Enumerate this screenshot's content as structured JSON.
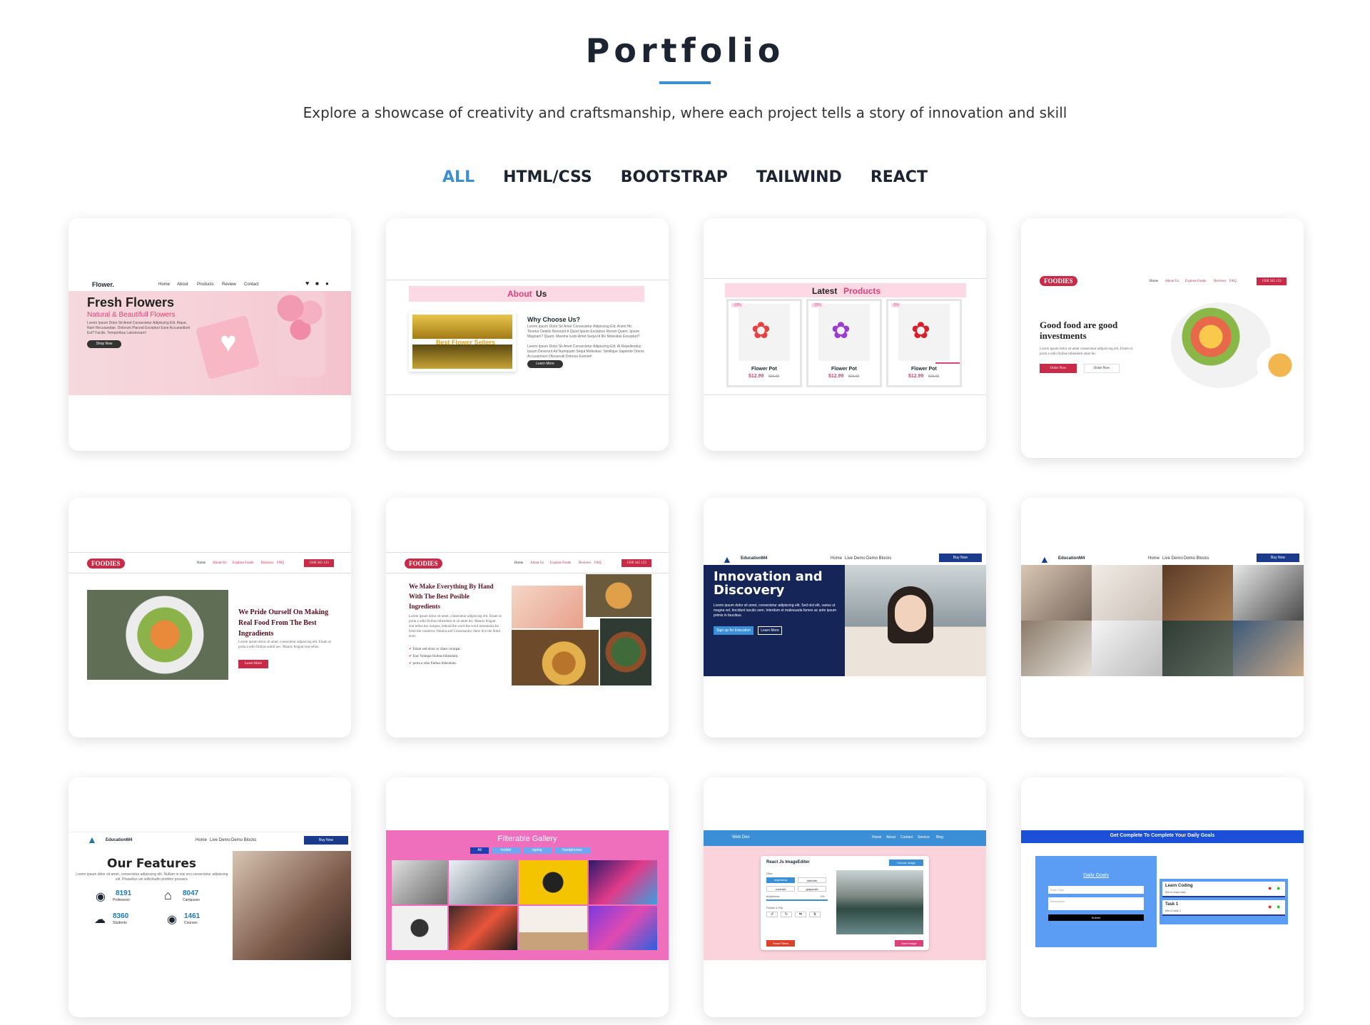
{
  "header": {
    "title": "Portfolio",
    "subtitle": "Explore a showcase of creativity and craftsmanship, where each project tells a story of innovation and skill"
  },
  "filters": [
    "ALL",
    "HTML/CSS",
    "BOOTSTRAP",
    "TAILWIND",
    "REACT"
  ],
  "accent": "#3a8fd6",
  "p1": {
    "logo": "Flower.",
    "nav": [
      "Home",
      "About",
      "Products",
      "Review",
      "Contact"
    ],
    "h": "Fresh Flowers",
    "sub": "Natural & Beautifull Flowers",
    "text": "Lorem Ipsum Dolor Sit Amet Consectetur Adipiscing Elit. Atque, Nam Recusandae. Dolorum Placeat Excepturi Esse Accusantium Est? Facilis. Temporibus Laboriosam!",
    "btn": "Shop Now"
  },
  "p2": {
    "t1": "About",
    "t2": "Us",
    "img": "Best Flower Sellers",
    "h": "Why Choose Us?",
    "text1": "Lorem Ipsum Dolor Sit Amet Consectetur Adipiscing Elit. Animi Hic Tenetur Debitis Nesciunt A Quod Ipsum Excepturi Rerum Quam. Ipsum Magnam? Quam, Maxime Iusto Amet Sequi Id Illo Molestias Excepturi?",
    "text2": "Lorem Ipsum Dolor Sit Amet Consectetur Adipiscing Elit. At Repellendus Ipsum Deserunt Ad Numquam Sequi Molestias. Similique Sapiente Omnis Accusantium Obcaecati Dolores Eveniet!",
    "btn": "Learn More"
  },
  "p3": {
    "t1": "Latest",
    "t2": "Products",
    "items": [
      {
        "badge": "-10%",
        "name": "Flower Pot",
        "price": "$12.99",
        "old": "$15.00"
      },
      {
        "badge": "-15%",
        "name": "Flower Pot",
        "price": "$12.99",
        "old": "$15.00"
      },
      {
        "badge": "-5%",
        "name": "Flower Pot",
        "price": "$12.99",
        "old": "$15.00"
      }
    ]
  },
  "foodies": {
    "logo": "FOODIES",
    "nav": [
      "Home",
      "About Us",
      "Explore Foods",
      "Reviews",
      "FAQ"
    ],
    "phone": "1500 345 123"
  },
  "p4": {
    "h": "Good food are good investments",
    "text": "Lorem ipsum dolor sit amet consectetur adipisicing elit. Etiam ut porta a odio finibus bibendum amet far.",
    "b1": "Order Now",
    "b2": "Order Now"
  },
  "p5": {
    "h": "We Pride Ourself On Making Real Food From The Best Ingradients",
    "text": "Lorem ipsum dolor sit amet, consectetur adipiscing elit. Etiam ut porta a odio finibus sumit nec. Mauris feugiat erat tellus.",
    "btn": "Learn More"
  },
  "p6": {
    "h": "We Make Everything By Hand With The Best Posible Ingredients",
    "text": "Lorem ipsum dolor sit amet, consectetur adipiscing elit. Etiam ut porta a odio finibus bibendum in sit amet leo. Mauris feugiat erat tellus hac tempus, behind the word the word mountains,far from the countries Vokalia and Consonantia, there live the blind texts.",
    "list": [
      "Etiam sed dolor ac diam volutpat.",
      "Erat Volutpat finibus bibendum.",
      "porta a odio finibus bibendum."
    ]
  },
  "edu": {
    "logo": "EducationM4",
    "nav": [
      "Home",
      "Live Demo",
      "Demo Blocks"
    ],
    "btn": "Buy Now"
  },
  "p7": {
    "h1": "Innovation and",
    "h2": "Discovery",
    "text": "Lorem ipsum dolor sit amet, consectetur adipiscing elit. Sed nisl elit, varius ut magna vel, tincidunt iaculis sem. Interdum et malesuada fames ac ante ipsum primis in faucibus.",
    "b1": "Sign up for Education",
    "b2": "Learn More"
  },
  "p9": {
    "h": "Our Features",
    "text": "Lorem ipsum dolor sit amet, consectetur adipiscing elit. Nullam in nisi orci consectetur adipiscing elit. Phasellus vel sollicitudin porttitor posuere.",
    "stats": [
      {
        "n": "8191",
        "l": "Professors"
      },
      {
        "n": "8047",
        "l": "Campuses"
      },
      {
        "n": "8360",
        "l": "Students"
      },
      {
        "n": "1461",
        "l": "Courses"
      }
    ]
  },
  "p10": {
    "title": "Filterable Gallery",
    "tabs": [
      "All",
      "mobile",
      "laptop",
      "headphones"
    ]
  },
  "p11": {
    "brand": "Web Dev",
    "nav": [
      "Home",
      "About",
      "Contact",
      "Service",
      "Blog"
    ],
    "h": "React Js ImageEditer",
    "choose": "Choose Image",
    "filter": "Filter",
    "opts": [
      "brightness",
      "saturate",
      "contrast",
      "grayscale"
    ],
    "bright": "brightness",
    "pct": "0%",
    "rot": "Rotate & Flip",
    "reset": "Reset Filters",
    "save": "Save Image"
  },
  "p12": {
    "title": "Get Complete To Complete Your Daily Goals",
    "goals": "Daily Goals",
    "ph1": "Enter Task",
    "ph2": "Description",
    "submit": "Submit",
    "tasks": [
      {
        "n": "Learn Coding",
        "d": "this is react task"
      },
      {
        "n": "Task 1",
        "d": "this is task 1"
      }
    ]
  }
}
